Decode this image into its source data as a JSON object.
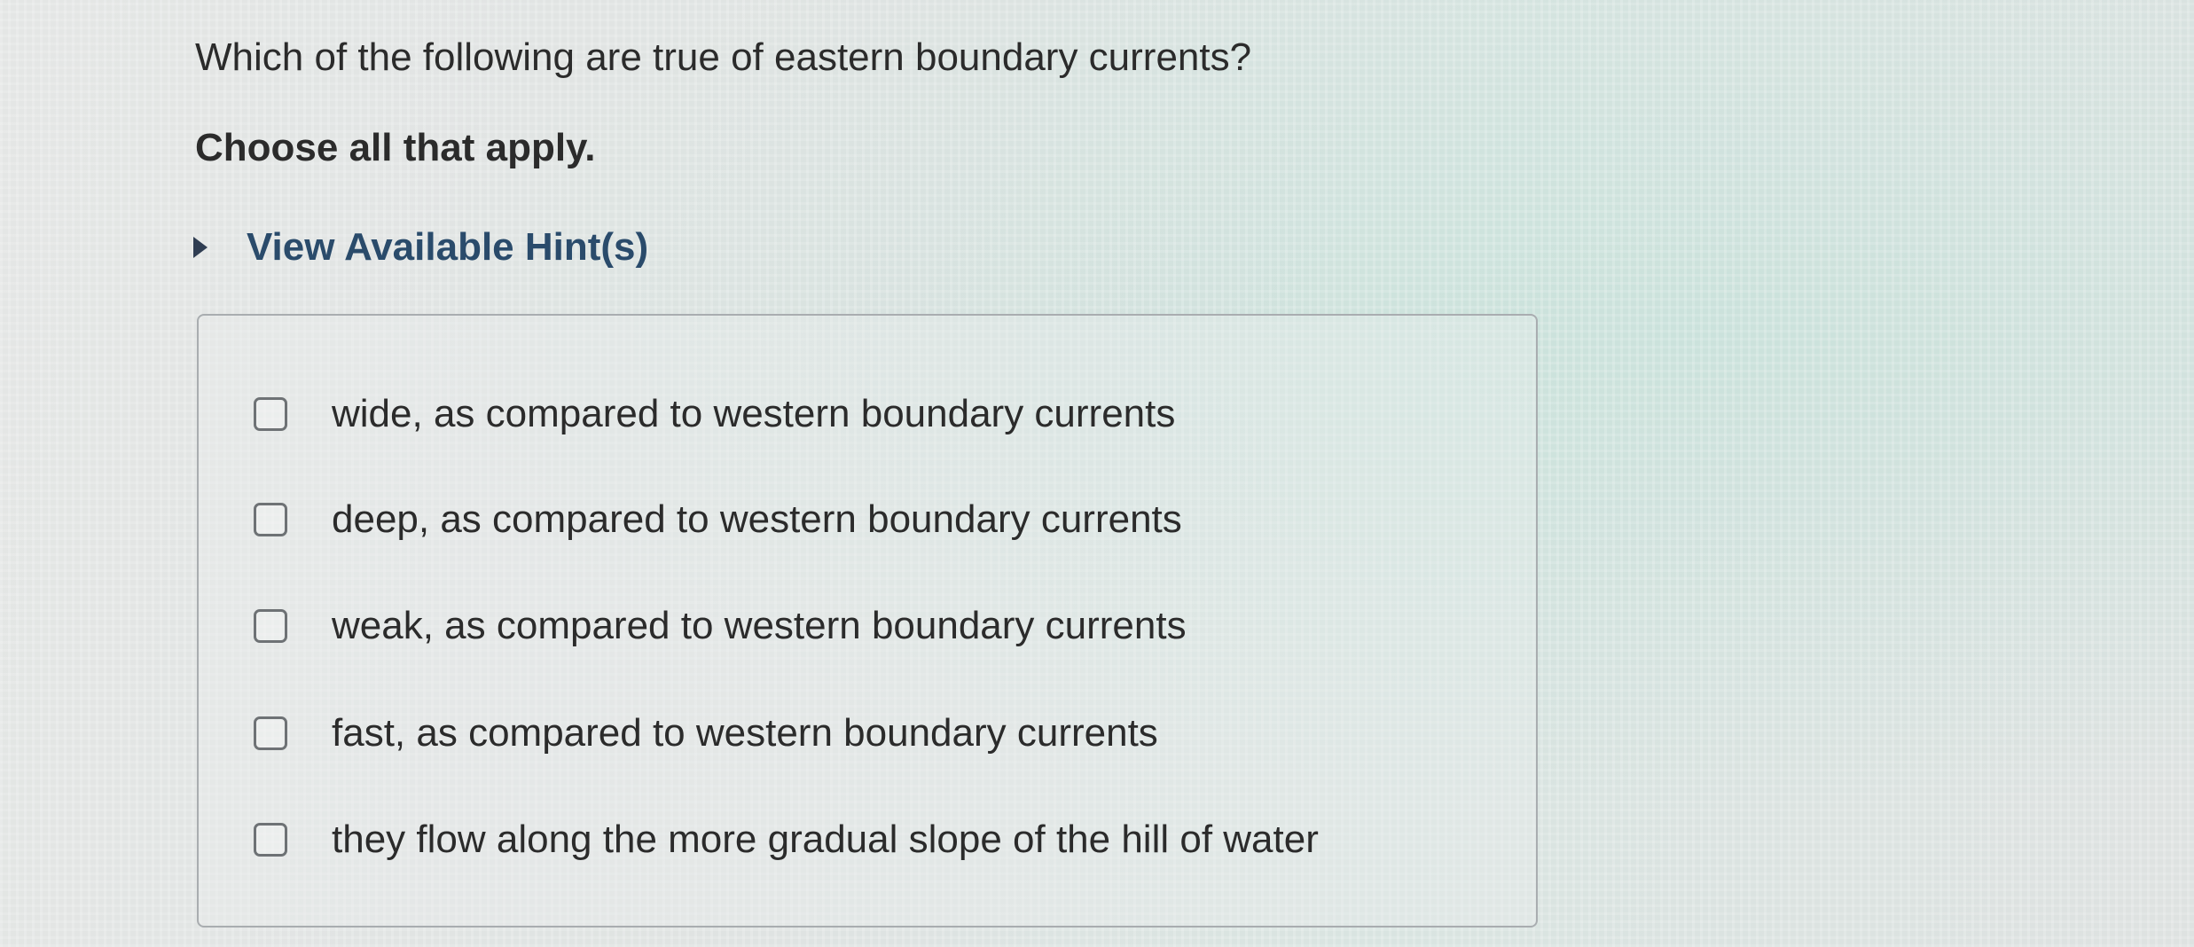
{
  "question": {
    "text": "Which of the following are true of eastern boundary currents?",
    "instruction": "Choose all that apply."
  },
  "hints": {
    "label": "View Available Hint(s)",
    "expanded": false,
    "icon": "triangle-right-icon"
  },
  "options": [
    {
      "label": "wide, as compared to western boundary currents",
      "checked": false
    },
    {
      "label": "deep, as compared to western boundary currents",
      "checked": false
    },
    {
      "label": "weak, as compared to western boundary currents",
      "checked": false
    },
    {
      "label": "fast, as compared to western boundary currents",
      "checked": false
    },
    {
      "label": "they flow along the more gradual slope of the hill of water",
      "checked": false
    }
  ],
  "colors": {
    "text": "#2b2b2b",
    "hint": "#2a4b6b",
    "border": "#a9adb0",
    "checkbox_border": "#6e7275"
  }
}
